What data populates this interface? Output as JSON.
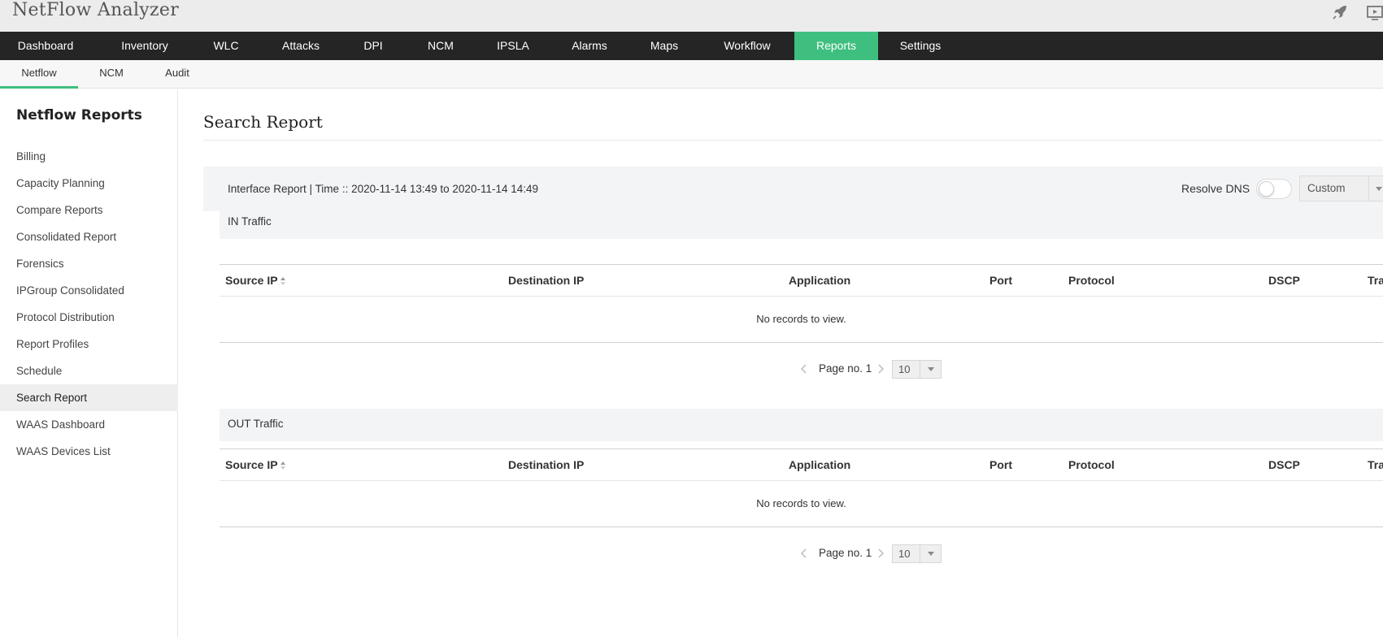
{
  "app": {
    "title": "NetFlow Analyzer"
  },
  "header_icons": [
    "rocket-icon",
    "screen-share-icon"
  ],
  "main_nav": [
    {
      "label": "Dashboard"
    },
    {
      "label": "Inventory"
    },
    {
      "label": "WLC"
    },
    {
      "label": "Attacks"
    },
    {
      "label": "DPI"
    },
    {
      "label": "NCM"
    },
    {
      "label": "IPSLA"
    },
    {
      "label": "Alarms"
    },
    {
      "label": "Maps"
    },
    {
      "label": "Workflow"
    },
    {
      "label": "Reports",
      "active": true
    },
    {
      "label": "Settings"
    }
  ],
  "sub_nav": [
    {
      "label": "Netflow",
      "active": true
    },
    {
      "label": "NCM"
    },
    {
      "label": "Audit"
    }
  ],
  "sidebar": {
    "title": "Netflow Reports",
    "items": [
      {
        "label": "Billing"
      },
      {
        "label": "Capacity Planning"
      },
      {
        "label": "Compare Reports"
      },
      {
        "label": "Consolidated Report"
      },
      {
        "label": "Forensics"
      },
      {
        "label": "IPGroup Consolidated"
      },
      {
        "label": "Protocol Distribution"
      },
      {
        "label": "Report Profiles"
      },
      {
        "label": "Schedule"
      },
      {
        "label": "Search Report",
        "active": true
      },
      {
        "label": "WAAS Dashboard"
      },
      {
        "label": "WAAS Devices List"
      }
    ]
  },
  "main": {
    "title": "Search Report",
    "filter": {
      "text": "Interface Report | Time :: 2020-11-14 13:49 to 2020-11-14 14:49",
      "resolve_dns_label": "Resolve DNS",
      "resolve_dns_on": false,
      "period_value": "Custom"
    },
    "columns": [
      "Source IP",
      "Destination IP",
      "Application",
      "Port",
      "Protocol",
      "DSCP",
      "Tra"
    ],
    "in_traffic": {
      "title": "IN Traffic",
      "empty_text": "No records to view.",
      "pager_label": "Page no. 1",
      "page_size": "10"
    },
    "out_traffic": {
      "title": "OUT Traffic",
      "empty_text": "No records to view.",
      "pager_label": "Page no. 1",
      "page_size": "10"
    }
  },
  "colors": {
    "accent": "#3fbf7f",
    "nav_background": "#252525",
    "header_background": "#ececec"
  }
}
